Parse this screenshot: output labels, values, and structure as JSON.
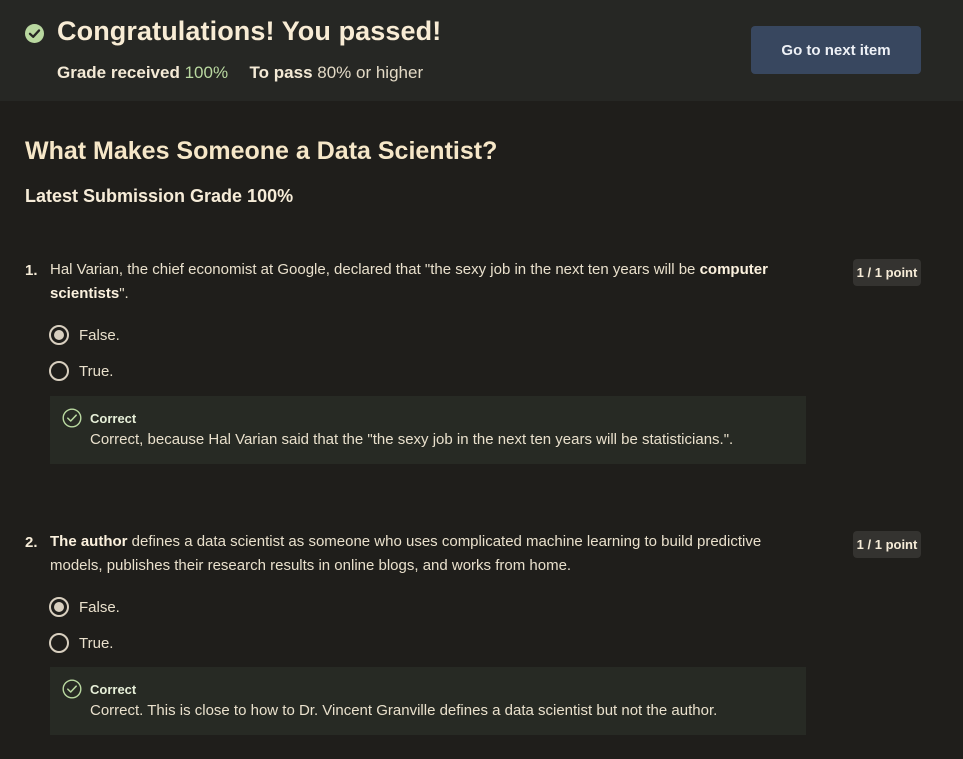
{
  "banner": {
    "title": "Congratulations! You passed!",
    "grade_label": "Grade received",
    "grade_value": "100%",
    "pass_label": "To pass",
    "pass_value": "80% or higher",
    "next_button": "Go to next item"
  },
  "quiz": {
    "title": "What Makes Someone a Data Scientist?",
    "latest_grade": "Latest Submission Grade 100%"
  },
  "questions": [
    {
      "number": "1.",
      "text_part1": "Hal Varian, the chief economist at Google, declared that \"the sexy job in the next ten years will be ",
      "text_bold": "computer scientists",
      "text_part2": "\".",
      "points": "1 / 1 point",
      "options": [
        {
          "label": "False.",
          "selected": true
        },
        {
          "label": "True.",
          "selected": false
        }
      ],
      "feedback_title": "Correct",
      "feedback_text": "Correct, because Hal Varian said that the \"the sexy job in the next ten years will be statisticians.\"."
    },
    {
      "number": "2.",
      "text_bold": "The author",
      "text_part1": " defines a data scientist as someone who uses complicated machine learning to build predictive models, publishes their research results in online blogs, and works from home.",
      "points": "1 / 1 point",
      "options": [
        {
          "label": "False.",
          "selected": true
        },
        {
          "label": "True.",
          "selected": false
        }
      ],
      "feedback_title": "Correct",
      "feedback_text": "Correct. This is close to how to Dr. Vincent Granville defines a data scientist but not the author."
    }
  ],
  "colors": {
    "accent_green": "#b9d8a0",
    "button_bg": "#38475f",
    "page_bg": "#1f1e1b"
  }
}
